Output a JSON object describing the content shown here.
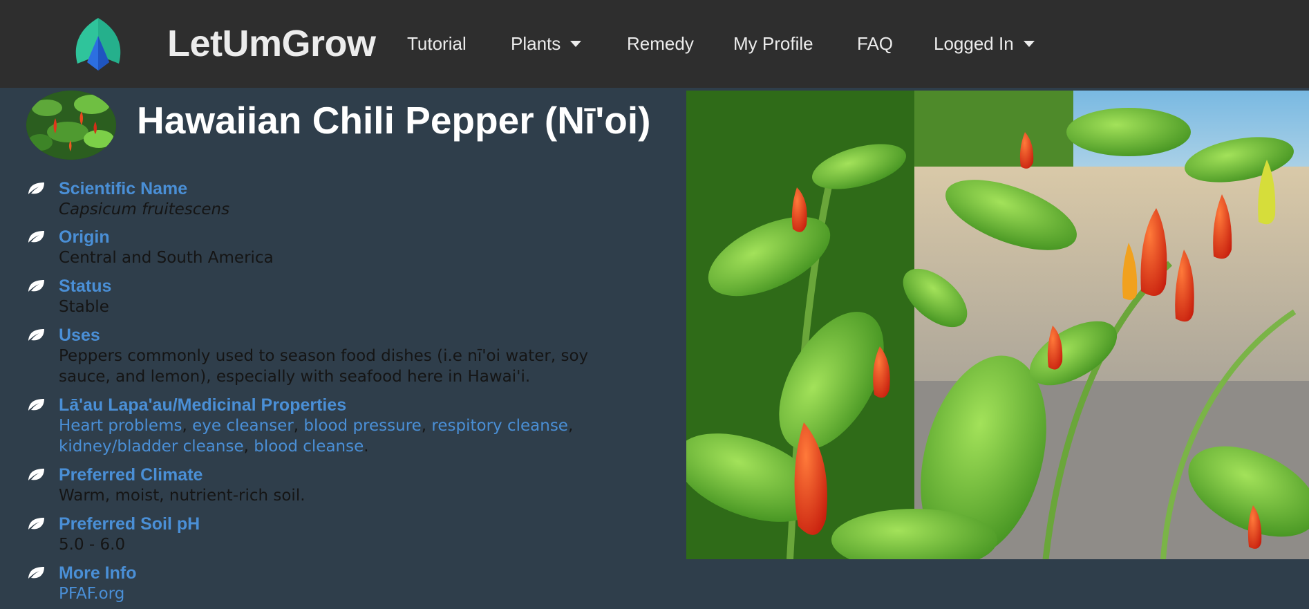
{
  "brand": {
    "name": "LetUmGrow",
    "colors": {
      "logo_green": "#2fc49b",
      "logo_blue": "#2c6fe0"
    }
  },
  "nav": {
    "items": [
      {
        "label": "Tutorial",
        "dropdown": false
      },
      {
        "label": "Plants",
        "dropdown": true
      },
      {
        "label": "Remedy",
        "dropdown": false
      },
      {
        "label": "My Profile",
        "dropdown": false
      },
      {
        "label": "FAQ",
        "dropdown": false
      },
      {
        "label": "Logged In",
        "dropdown": true
      }
    ]
  },
  "plant": {
    "title": "Hawaiian Chili Pepper (Nī'oi)",
    "scientific_name": {
      "label": "Scientific Name",
      "value": "Capsicum fruitescens"
    },
    "origin": {
      "label": "Origin",
      "value": "Central and South America"
    },
    "status": {
      "label": "Status",
      "value": "Stable"
    },
    "uses": {
      "label": "Uses",
      "value": "Peppers commonly used to season food dishes (i.e nī'oi water, soy sauce, and lemon), especially with seafood here in Hawai'i."
    },
    "medicinal": {
      "label": "Lā'au Lapa'au/Medicinal Properties",
      "links": [
        "Heart problems",
        "eye cleanser",
        "blood pressure",
        "respitory cleanse",
        "kidney/bladder cleanse",
        "blood cleanse"
      ],
      "separator": ", ",
      "end": "."
    },
    "climate": {
      "label": "Preferred Climate",
      "value": "Warm, moist, nutrient-rich soil."
    },
    "soil_ph": {
      "label": "Preferred Soil pH",
      "value": "5.0 - 6.0"
    },
    "more_info": {
      "label": "More Info",
      "link": "PFAF.org"
    }
  },
  "icons": {
    "fact_icon": "leaf-icon",
    "caret": "caret-down-icon"
  },
  "colors": {
    "nav_bg": "#2e2e2e",
    "page_bg": "#2f3e4b",
    "label": "#4a8fd6",
    "text": "#151515",
    "title": "#ffffff",
    "leaf": "#ffffff"
  }
}
